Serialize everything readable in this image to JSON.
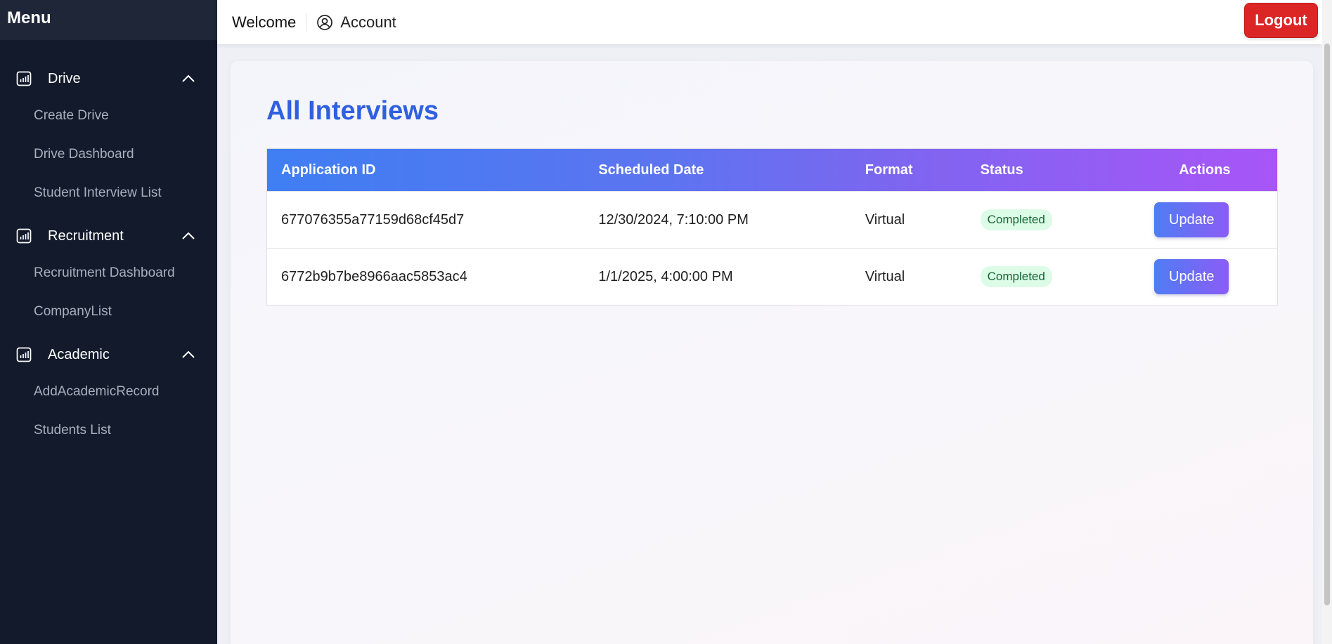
{
  "sidebar": {
    "title": "Menu",
    "sections": [
      {
        "label": "Drive",
        "icon": "bar-chart-icon",
        "items": [
          {
            "label": "Create Drive"
          },
          {
            "label": "Drive Dashboard"
          },
          {
            "label": "Student Interview List"
          }
        ]
      },
      {
        "label": "Recruitment",
        "icon": "bar-chart-icon",
        "items": [
          {
            "label": "Recruitment Dashboard"
          },
          {
            "label": "CompanyList"
          }
        ]
      },
      {
        "label": "Academic",
        "icon": "bar-chart-icon",
        "items": [
          {
            "label": "AddAcademicRecord"
          },
          {
            "label": "Students List"
          }
        ]
      }
    ]
  },
  "header": {
    "welcome": "Welcome",
    "account": "Account",
    "logout": "Logout"
  },
  "main": {
    "title": "All Interviews",
    "table": {
      "columns": [
        "Application ID",
        "Scheduled Date",
        "Format",
        "Status",
        "Actions"
      ],
      "rows": [
        {
          "application_id": "677076355a77159d68cf45d7",
          "date": "12/30/2024, 7:10:00 PM",
          "format": "Virtual",
          "status": "Completed",
          "action": "Update"
        },
        {
          "application_id": "6772b9b7be8966aac5853ac4",
          "date": "1/1/2025, 4:00:00 PM",
          "format": "Virtual",
          "status": "Completed",
          "action": "Update"
        }
      ]
    }
  },
  "colors": {
    "sidebar_bg": "#131a2b",
    "title_blue": "#2f60e0",
    "logout_red": "#dc2626",
    "status_green_bg": "#dcfce7",
    "status_green_text": "#166534"
  }
}
